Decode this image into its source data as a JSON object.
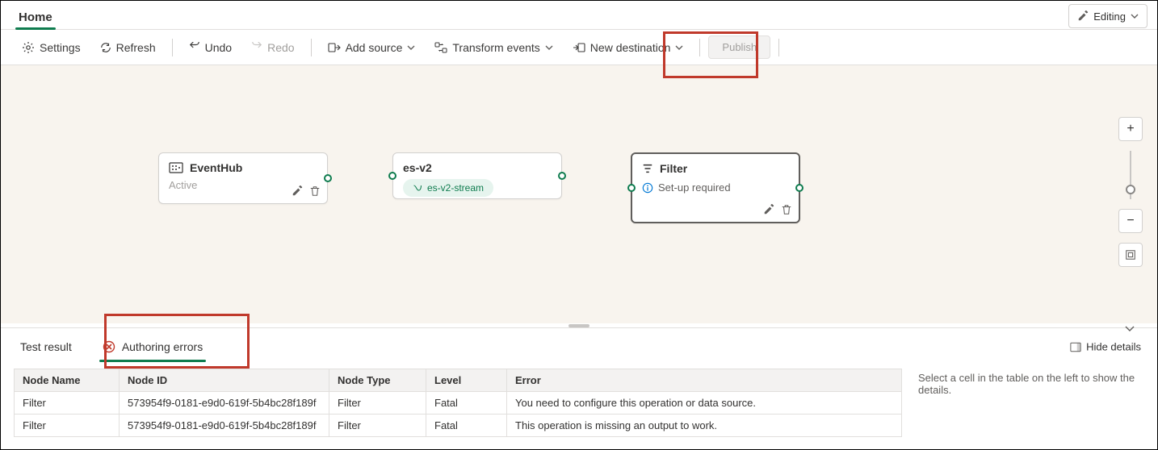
{
  "header": {
    "tab_label": "Home",
    "mode_label": "Editing"
  },
  "toolbar": {
    "settings": "Settings",
    "refresh": "Refresh",
    "undo": "Undo",
    "redo": "Redo",
    "add_source": "Add source",
    "transform_events": "Transform events",
    "new_destination": "New destination",
    "publish": "Publish"
  },
  "nodes": {
    "source": {
      "title": "EventHub",
      "status": "Active"
    },
    "stream": {
      "title": "es-v2",
      "pill": "es-v2-stream"
    },
    "filter": {
      "title": "Filter",
      "status": "Set-up required"
    }
  },
  "tabs": {
    "test_result": "Test result",
    "authoring_errors": "Authoring errors",
    "hide_details": "Hide details"
  },
  "errors_table": {
    "columns": [
      "Node Name",
      "Node ID",
      "Node Type",
      "Level",
      "Error"
    ],
    "rows": [
      {
        "node_name": "Filter",
        "node_id": "573954f9-0181-e9d0-619f-5b4bc28f189f",
        "node_type": "Filter",
        "level": "Fatal",
        "error": "You need to configure this operation or data source."
      },
      {
        "node_name": "Filter",
        "node_id": "573954f9-0181-e9d0-619f-5b4bc28f189f",
        "node_type": "Filter",
        "level": "Fatal",
        "error": "This operation is missing an output to work."
      }
    ]
  },
  "side_hint": "Select a cell in the table on the left to show the details.",
  "colors": {
    "accent": "#0f7c4f",
    "danger": "#c0392b"
  }
}
